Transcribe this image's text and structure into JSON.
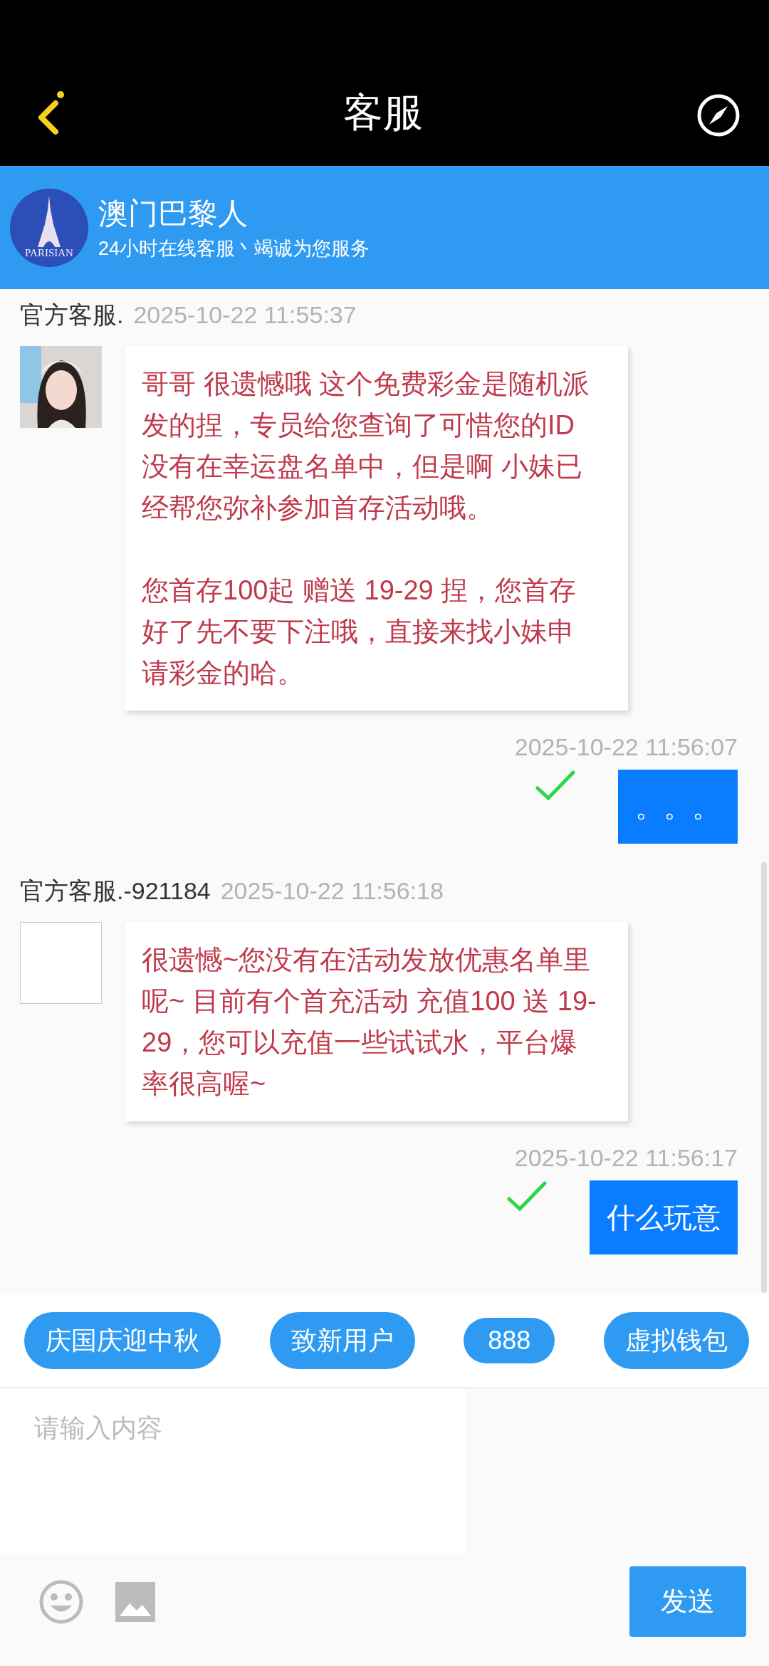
{
  "header": {
    "title": "客服"
  },
  "service": {
    "logo_text": "PARISIAN",
    "name": "澳门巴黎人",
    "tagline": "24小时在线客服丶竭诚为您服务"
  },
  "messages": [
    {
      "kind": "incoming",
      "sender": "官方客服.",
      "time": "2025-10-22 11:55:37",
      "paragraphs": [
        "哥哥 很遗憾哦 这个免费彩金是随机派发的捏，专员给您查询了可惜您的ID没有在幸运盘名单中，但是啊 小妹已经帮您弥补参加首存活动哦。",
        "您首存100起 赠送 19-29 捏，您首存好了先不要下注哦，直接来找小妹申请彩金的哈。"
      ]
    },
    {
      "kind": "outgoing",
      "time": "2025-10-22 11:56:07",
      "delivered": true,
      "text": "。。。"
    },
    {
      "kind": "incoming",
      "sender": "官方客服.-921184",
      "time": "2025-10-22 11:56:18",
      "avatar": {
        "kind": "empty"
      },
      "paragraphs": [
        "很遗憾~您没有在活动发放优惠名单里呢~ 目前有个首充活动 充值100 送 19-29，您可以充值一些试试水，平台爆率很高喔~"
      ]
    },
    {
      "kind": "outgoing",
      "time": "2025-10-22 11:56:17",
      "delivered": true,
      "text": "什么玩意"
    }
  ],
  "quick_replies": [
    "庆国庆迎中秋",
    "致新用户",
    "888",
    "虚拟钱包"
  ],
  "composer": {
    "placeholder": "请输入内容",
    "send": "发送"
  }
}
